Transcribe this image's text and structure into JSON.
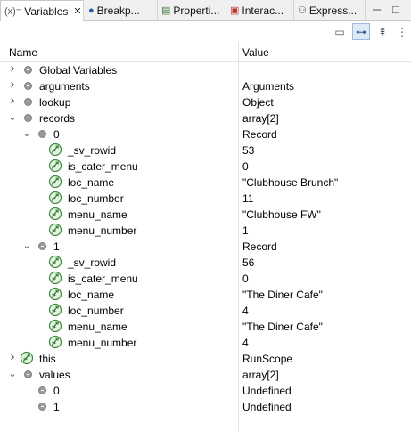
{
  "tabs": [
    {
      "label": "Variables",
      "glyph": "(x)=",
      "icon": "variables-icon",
      "active": true,
      "close": "✕"
    },
    {
      "label": "Breakp...",
      "glyph": "●",
      "icon": "breakpoints-icon"
    },
    {
      "label": "Properti...",
      "glyph": "▤",
      "icon": "properties-icon"
    },
    {
      "label": "Interac...",
      "glyph": "▣",
      "icon": "interactive-icon"
    },
    {
      "label": "Express...",
      "glyph": "⚇",
      "icon": "expressions-icon"
    }
  ],
  "window": {
    "minimize": "─",
    "maximize": "□"
  },
  "toolbar": [
    {
      "name": "show-type-names-icon",
      "glyph": "▭",
      "active": false
    },
    {
      "name": "show-logical-structure-icon",
      "glyph": "⊶",
      "active": true
    },
    {
      "name": "collapse-all-icon",
      "glyph": "⇞",
      "active": false
    },
    {
      "name": "view-menu-icon",
      "glyph": "⋮",
      "active": false
    }
  ],
  "columns": {
    "name": "Name",
    "value": "Value"
  },
  "rows": [
    {
      "name": "Global Variables",
      "value": "",
      "level": 0,
      "expander": "collapsed",
      "icon": "dot"
    },
    {
      "name": "arguments",
      "value": "Arguments",
      "level": 0,
      "expander": "collapsed",
      "icon": "dot"
    },
    {
      "name": "lookup",
      "value": "Object",
      "level": 0,
      "expander": "collapsed",
      "icon": "dot"
    },
    {
      "name": "records",
      "value": "array[2]",
      "level": 0,
      "expander": "expanded",
      "icon": "dot"
    },
    {
      "name": "0",
      "value": "Record",
      "level": 1,
      "expander": "expanded",
      "icon": "dot"
    },
    {
      "name": "_sv_rowid",
      "value": "53",
      "level": 2,
      "expander": "none",
      "icon": "sv"
    },
    {
      "name": "is_cater_menu",
      "value": "0",
      "level": 2,
      "expander": "none",
      "icon": "sv"
    },
    {
      "name": "loc_name",
      "value": "\"Clubhouse Brunch\"",
      "level": 2,
      "expander": "none",
      "icon": "sv"
    },
    {
      "name": "loc_number",
      "value": "11",
      "level": 2,
      "expander": "none",
      "icon": "sv"
    },
    {
      "name": "menu_name",
      "value": "\"Clubhouse FW\"",
      "level": 2,
      "expander": "none",
      "icon": "sv"
    },
    {
      "name": "menu_number",
      "value": "1",
      "level": 2,
      "expander": "none",
      "icon": "sv"
    },
    {
      "name": "1",
      "value": "Record",
      "level": 1,
      "expander": "expanded",
      "icon": "dot"
    },
    {
      "name": "_sv_rowid",
      "value": "56",
      "level": 2,
      "expander": "none",
      "icon": "sv"
    },
    {
      "name": "is_cater_menu",
      "value": "0",
      "level": 2,
      "expander": "none",
      "icon": "sv"
    },
    {
      "name": "loc_name",
      "value": "\"The Diner Cafe\"",
      "level": 2,
      "expander": "none",
      "icon": "sv"
    },
    {
      "name": "loc_number",
      "value": "4",
      "level": 2,
      "expander": "none",
      "icon": "sv"
    },
    {
      "name": "menu_name",
      "value": "\"The Diner Cafe\"",
      "level": 2,
      "expander": "none",
      "icon": "sv"
    },
    {
      "name": "menu_number",
      "value": "4",
      "level": 2,
      "expander": "none",
      "icon": "sv"
    },
    {
      "name": "this",
      "value": "RunScope",
      "level": 0,
      "expander": "collapsed",
      "icon": "sv"
    },
    {
      "name": "values",
      "value": "array[2]",
      "level": 0,
      "expander": "expanded",
      "icon": "dot"
    },
    {
      "name": "0",
      "value": "Undefined",
      "level": 1,
      "expander": "none",
      "icon": "dot"
    },
    {
      "name": "1",
      "value": "Undefined",
      "level": 1,
      "expander": "none",
      "icon": "dot"
    }
  ],
  "colors": {
    "variable_icon": "#3f8a3f",
    "variable_icon_bg": "#e4f3e4",
    "object_dot": "#9a9a9a",
    "toggle_active": "#dfe9f5"
  }
}
